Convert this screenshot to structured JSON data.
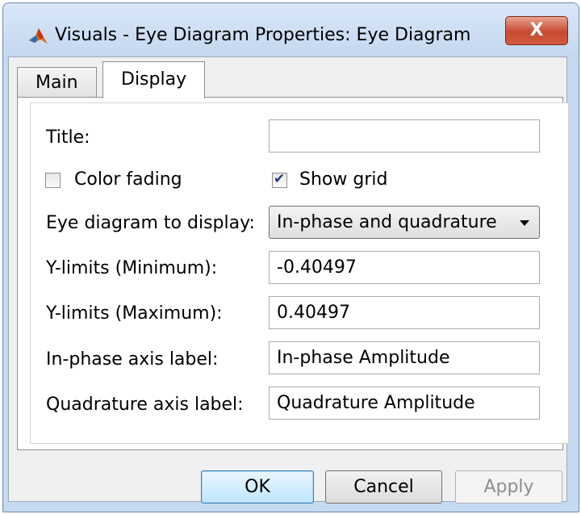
{
  "window": {
    "title": "Visuals - Eye Diagram Properties: Eye Diagram",
    "close_glyph": "X",
    "icon": "matlab-logo-icon"
  },
  "tabs": [
    {
      "label": "Main",
      "active": false
    },
    {
      "label": "Display",
      "active": true
    }
  ],
  "form": {
    "title_label": "Title:",
    "title_value": "",
    "color_fading_label": "Color fading",
    "color_fading_checked": false,
    "show_grid_label": "Show grid",
    "show_grid_checked": true,
    "eye_diagram_label": "Eye diagram to display:",
    "eye_diagram_value": "In-phase and quadrature",
    "ymin_label": "Y-limits (Minimum):",
    "ymin_value": "-0.40497",
    "ymax_label": "Y-limits (Maximum):",
    "ymax_value": "0.40497",
    "inphase_label": "In-phase axis label:",
    "inphase_value": "In-phase Amplitude",
    "quadrature_label": "Quadrature axis label:",
    "quadrature_value": "Quadrature Amplitude"
  },
  "buttons": {
    "ok": "OK",
    "cancel": "Cancel",
    "apply": "Apply"
  },
  "colors": {
    "window_frame": "#c5d9f1",
    "close_button": "#c74a33",
    "default_button": "#bee6fd"
  }
}
